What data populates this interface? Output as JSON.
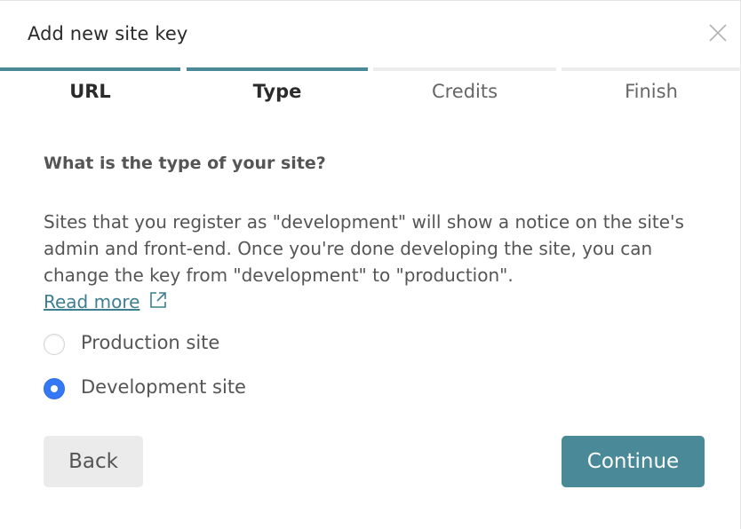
{
  "dialog": {
    "title": "Add new site key",
    "close_icon": "close-icon"
  },
  "steps": [
    {
      "label": "URL",
      "state": "done"
    },
    {
      "label": "Type",
      "state": "done"
    },
    {
      "label": "Credits",
      "state": "pending"
    },
    {
      "label": "Finish",
      "state": "pending"
    }
  ],
  "content": {
    "question": "What is the type of your site?",
    "description": "Sites that you register as \"development\" will show a notice on the site's admin and front-end. Once you're done developing the site, you can change the key from \"development\" to \"production\".",
    "read_more": "Read more",
    "read_more_icon": "external-link-icon"
  },
  "options": [
    {
      "label": "Production site",
      "checked": false
    },
    {
      "label": "Development site",
      "checked": true
    }
  ],
  "buttons": {
    "back": "Back",
    "continue": "Continue"
  },
  "colors": {
    "accent": "#4a8a98",
    "link": "#3d7f91",
    "radio_checked": "#3478f6",
    "step_pending": "#ededed"
  }
}
